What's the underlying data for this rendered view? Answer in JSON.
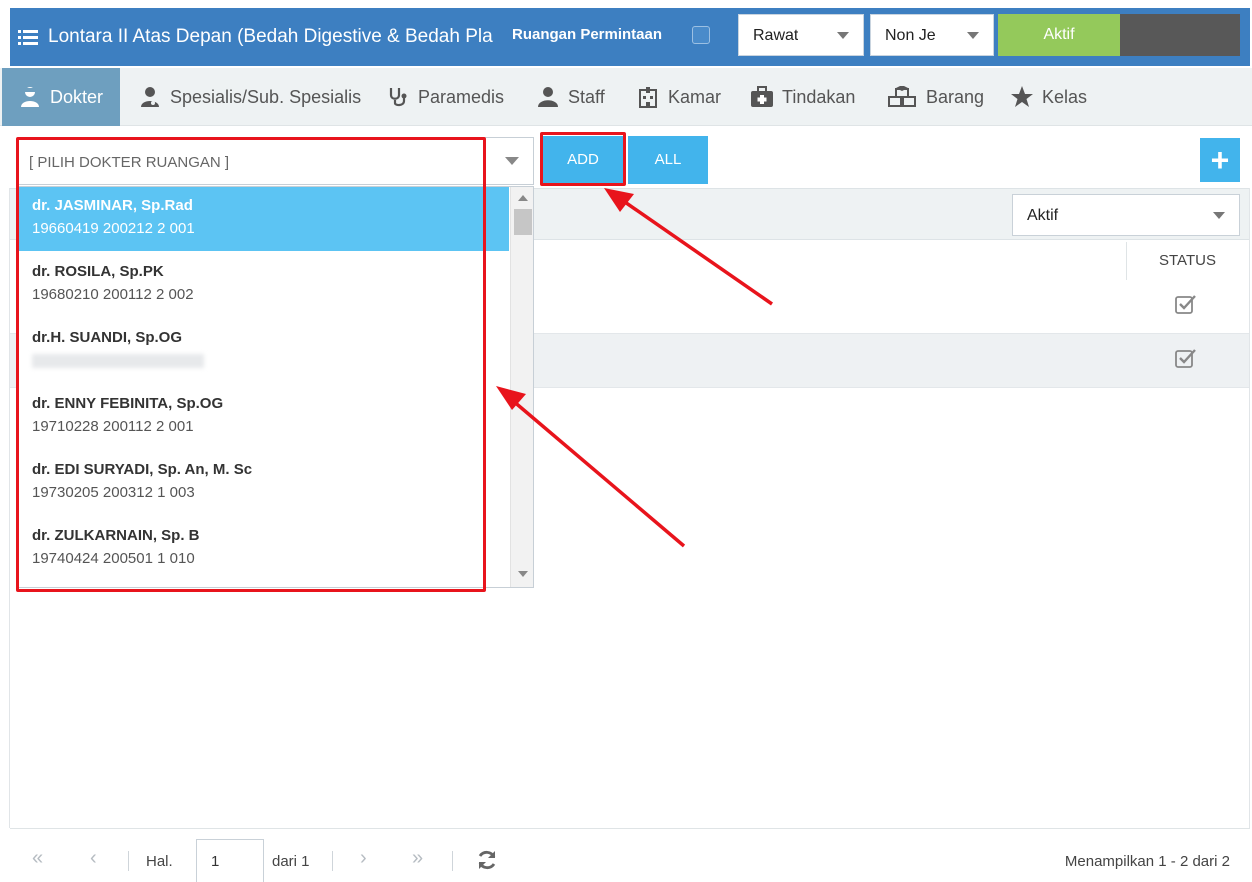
{
  "header": {
    "title": "Lontara II Atas Depan (Bedah Digestive & Bedah Pla",
    "request_label": "Ruangan Permintaan",
    "select_rawat": "Rawat",
    "select_non": "Non Je",
    "aktif_label": "Aktif"
  },
  "tabs": [
    {
      "label": "Dokter",
      "icon": "doctor-icon"
    },
    {
      "label": "Spesialis/Sub. Spesialis",
      "icon": "user-md-icon"
    },
    {
      "label": "Paramedis",
      "icon": "stethoscope-icon"
    },
    {
      "label": "Staff",
      "icon": "user-icon"
    },
    {
      "label": "Kamar",
      "icon": "hospital-icon"
    },
    {
      "label": "Tindakan",
      "icon": "medkit-icon"
    },
    {
      "label": "Barang",
      "icon": "cubes-icon"
    },
    {
      "label": "Kelas",
      "icon": "star-icon"
    }
  ],
  "toolbar": {
    "combo_placeholder": "[ PILIH DOKTER RUANGAN ]",
    "add_label": "ADD",
    "all_label": "ALL",
    "plus_label": "+"
  },
  "grid": {
    "filter_value": "Aktif",
    "status_header": "STATUS"
  },
  "dropdown": {
    "items": [
      {
        "name": "dr. JASMINAR, Sp.Rad",
        "nip": "19660419 200212 2 001"
      },
      {
        "name": "dr. ROSILA, Sp.PK",
        "nip": "19680210 200112 2 002"
      },
      {
        "name": "dr.H. SUANDI, Sp.OG",
        "nip": ""
      },
      {
        "name": "dr. ENNY FEBINITA, Sp.OG",
        "nip": "19710228 200112 2 001"
      },
      {
        "name": "dr. EDI SURYADI, Sp. An, M. Sc",
        "nip": "19730205 200312 1 003"
      },
      {
        "name": "dr. ZULKARNAIN, Sp. B",
        "nip": "19740424 200501 1 010"
      }
    ]
  },
  "footer": {
    "first": "«",
    "prev": "‹",
    "hal_label": "Hal.",
    "page_value": "1",
    "dari_label": "dari 1",
    "next": "›",
    "last": "»",
    "showing": "Menampilkan 1 - 2 dari 2"
  },
  "colors": {
    "header_bg": "#3d7fc1",
    "tab_active": "#6e9fbf",
    "button_blue": "#42b4ec",
    "aktif_green": "#94c95b",
    "highlight_red": "#e8141c"
  }
}
